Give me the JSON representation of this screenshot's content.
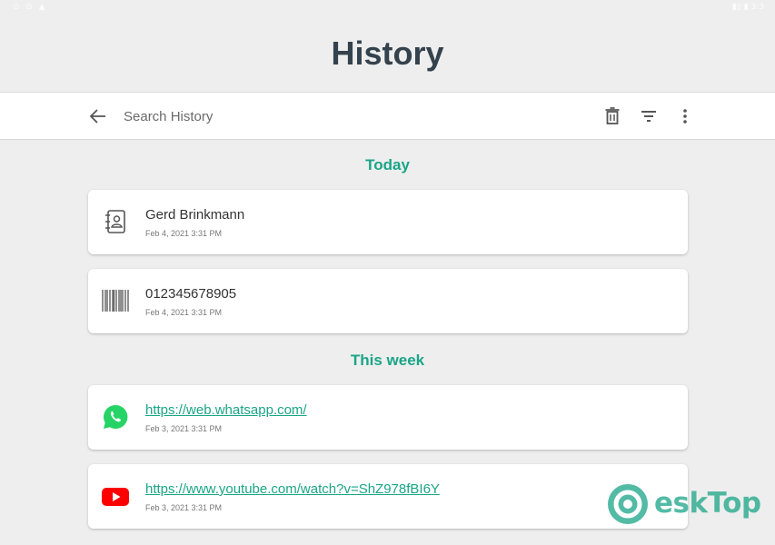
{
  "status_bar": {
    "left": "⊙ ⊙ ▲",
    "right": "▮▯ ▮ 3:3"
  },
  "page": {
    "title": "History"
  },
  "search": {
    "placeholder": "Search History"
  },
  "toolbar": {
    "icons": [
      "back-arrow-icon",
      "trash-icon",
      "filter-icon",
      "more-vert-icon"
    ]
  },
  "sections": [
    {
      "header": "Today",
      "items": [
        {
          "icon": "contact-book-icon",
          "title": "Gerd Brinkmann",
          "date": "Feb 4, 2021 3:31 PM"
        },
        {
          "icon": "barcode-icon",
          "title": "012345678905",
          "date": "Feb 4, 2021 3:31 PM"
        }
      ]
    },
    {
      "header": "This week",
      "items": [
        {
          "icon": "whatsapp-icon",
          "title": "https://web.whatsapp.com/",
          "date": "Feb 3, 2021 3:31 PM"
        },
        {
          "icon": "youtube-icon",
          "title": "https://www.youtube.com/watch?v=ShZ978fBI6Y",
          "date": "Feb 3, 2021 3:31 PM"
        }
      ]
    }
  ],
  "watermark": {
    "text": "eskTop"
  },
  "colors": {
    "accent": "#1aa587",
    "title": "#34424d",
    "background": "#eeeeee",
    "whatsapp": "#25d366",
    "youtube": "#ff0000"
  }
}
